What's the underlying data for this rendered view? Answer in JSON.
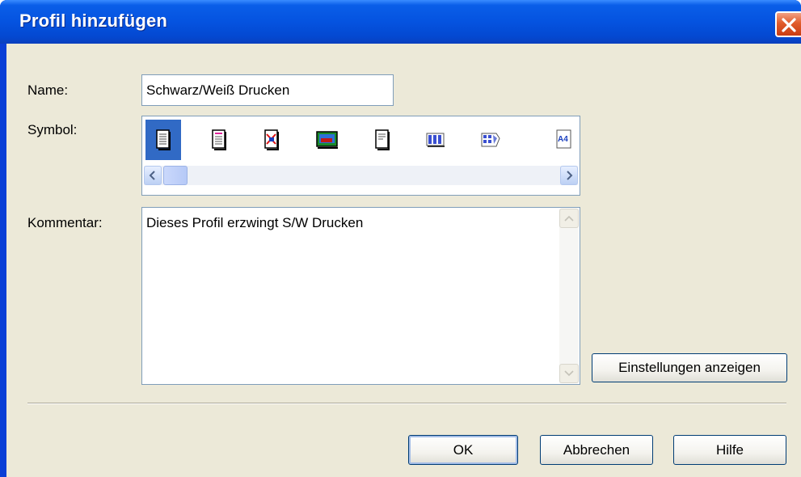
{
  "window": {
    "title": "Profil hinzufügen"
  },
  "form": {
    "name_label": "Name:",
    "name_value": "Schwarz/Weiß Drucken",
    "symbol_label": "Symbol:",
    "comment_label": "Kommentar:",
    "comment_value": "Dieses Profil erzwingt S/W Drucken"
  },
  "icons": [
    {
      "name": "document-lines-icon",
      "selected": true
    },
    {
      "name": "document-pink-lines-icon",
      "selected": false
    },
    {
      "name": "document-red-x-icon",
      "selected": false
    },
    {
      "name": "picture-icon",
      "selected": false
    },
    {
      "name": "document-text-icon",
      "selected": false
    },
    {
      "name": "multipage-grid-icon",
      "selected": false
    },
    {
      "name": "booklet-icon",
      "selected": false
    },
    {
      "name": "a4-paper-icon",
      "selected": false
    }
  ],
  "buttons": {
    "show_settings": "Einstellungen anzeigen",
    "ok": "OK",
    "cancel": "Abbrechen",
    "help": "Hilfe"
  },
  "colors": {
    "title_bar": "#0553e0",
    "dialog_bg": "#ece9d8",
    "selection": "#316ac5",
    "close_button": "#e15c2b"
  }
}
